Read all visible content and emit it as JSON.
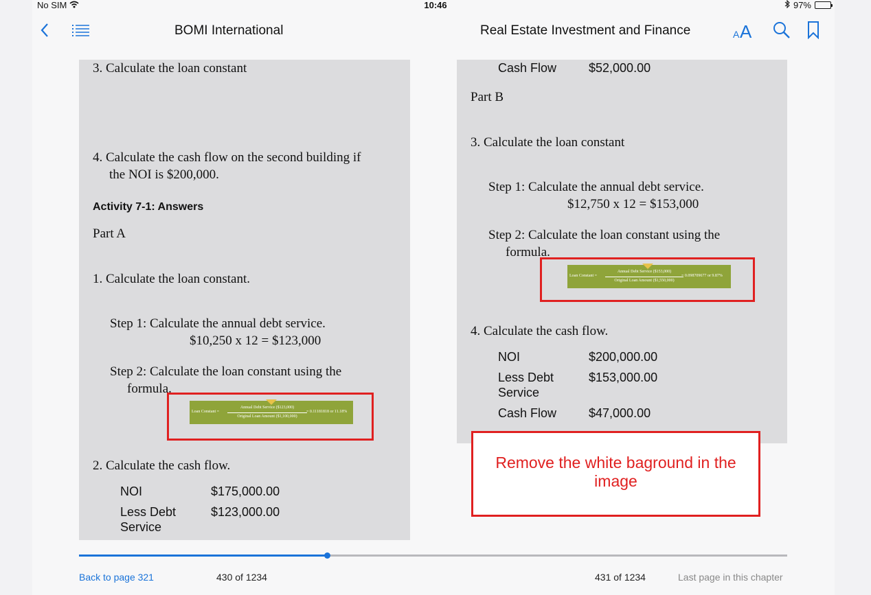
{
  "status_bar": {
    "carrier": "No SIM",
    "time": "10:46",
    "battery": "97%"
  },
  "nav": {
    "book_title": "BOMI International",
    "chapter_title": "Real Estate Investment and Finance"
  },
  "left_page": {
    "q3": "3. Calculate the loan constant",
    "q4_line1": "4. Calculate the cash flow on the second building if",
    "q4_line2": "the NOI is $200,000.",
    "heading": "Activity 7-1: Answers",
    "part": "Part A",
    "a1": "1. Calculate the loan constant.",
    "step1": "Step 1: Calculate the annual debt service.",
    "step1_calc": "$10,250 x 12 = $123,000",
    "step2_line1": "Step 2: Calculate the loan constant using the",
    "step2_line2": "formula.",
    "formula": {
      "label": "Loan Constant =",
      "numerator": "Annual Debt Service ($123,000)",
      "denominator": "Original Loan Amount ($1,100,000)",
      "result": "= 0.11181818 or 11.18%"
    },
    "a2": "2. Calculate the cash flow.",
    "rows": [
      {
        "label": "NOI",
        "value": "$175,000.00"
      },
      {
        "label": "Less Debt Service",
        "label1": "Less Debt",
        "label2": "Service",
        "value": "$123,000.00"
      }
    ]
  },
  "right_page": {
    "top_row": {
      "label": "Cash Flow",
      "value": "$52,000.00"
    },
    "part": "Part B",
    "q3": "3. Calculate the loan constant",
    "step1": "Step 1: Calculate the annual debt service.",
    "step1_calc": "$12,750 x 12 = $153,000",
    "step2_line1": "Step 2: Calculate the loan constant using the",
    "step2_line2": "formula.",
    "formula": {
      "label": "Loan Constant =",
      "numerator": "Annual Debt Service ($153,000)",
      "denominator": "Original Loan Amount ($1,550,000)",
      "result": "= 0.098709677 or 9.87%"
    },
    "q4": "4. Calculate the cash flow.",
    "rows": [
      {
        "label": "NOI",
        "value": "$200,000.00"
      },
      {
        "label1": "Less Debt",
        "label2": "Service",
        "value": "$153,000.00"
      },
      {
        "label": "Cash Flow",
        "value": "$47,000.00"
      }
    ]
  },
  "note": "Remove the white baground in the image",
  "progress": {
    "fraction": 0.35
  },
  "footer": {
    "back_link": "Back to page 321",
    "left_page_num": "430 of 1234",
    "right_page_num": "431 of 1234",
    "last_page": "Last page in this chapter"
  },
  "colors": {
    "accent": "#1a73d9",
    "annotation_red": "#e02020",
    "formula_green": "#8fa43a"
  }
}
